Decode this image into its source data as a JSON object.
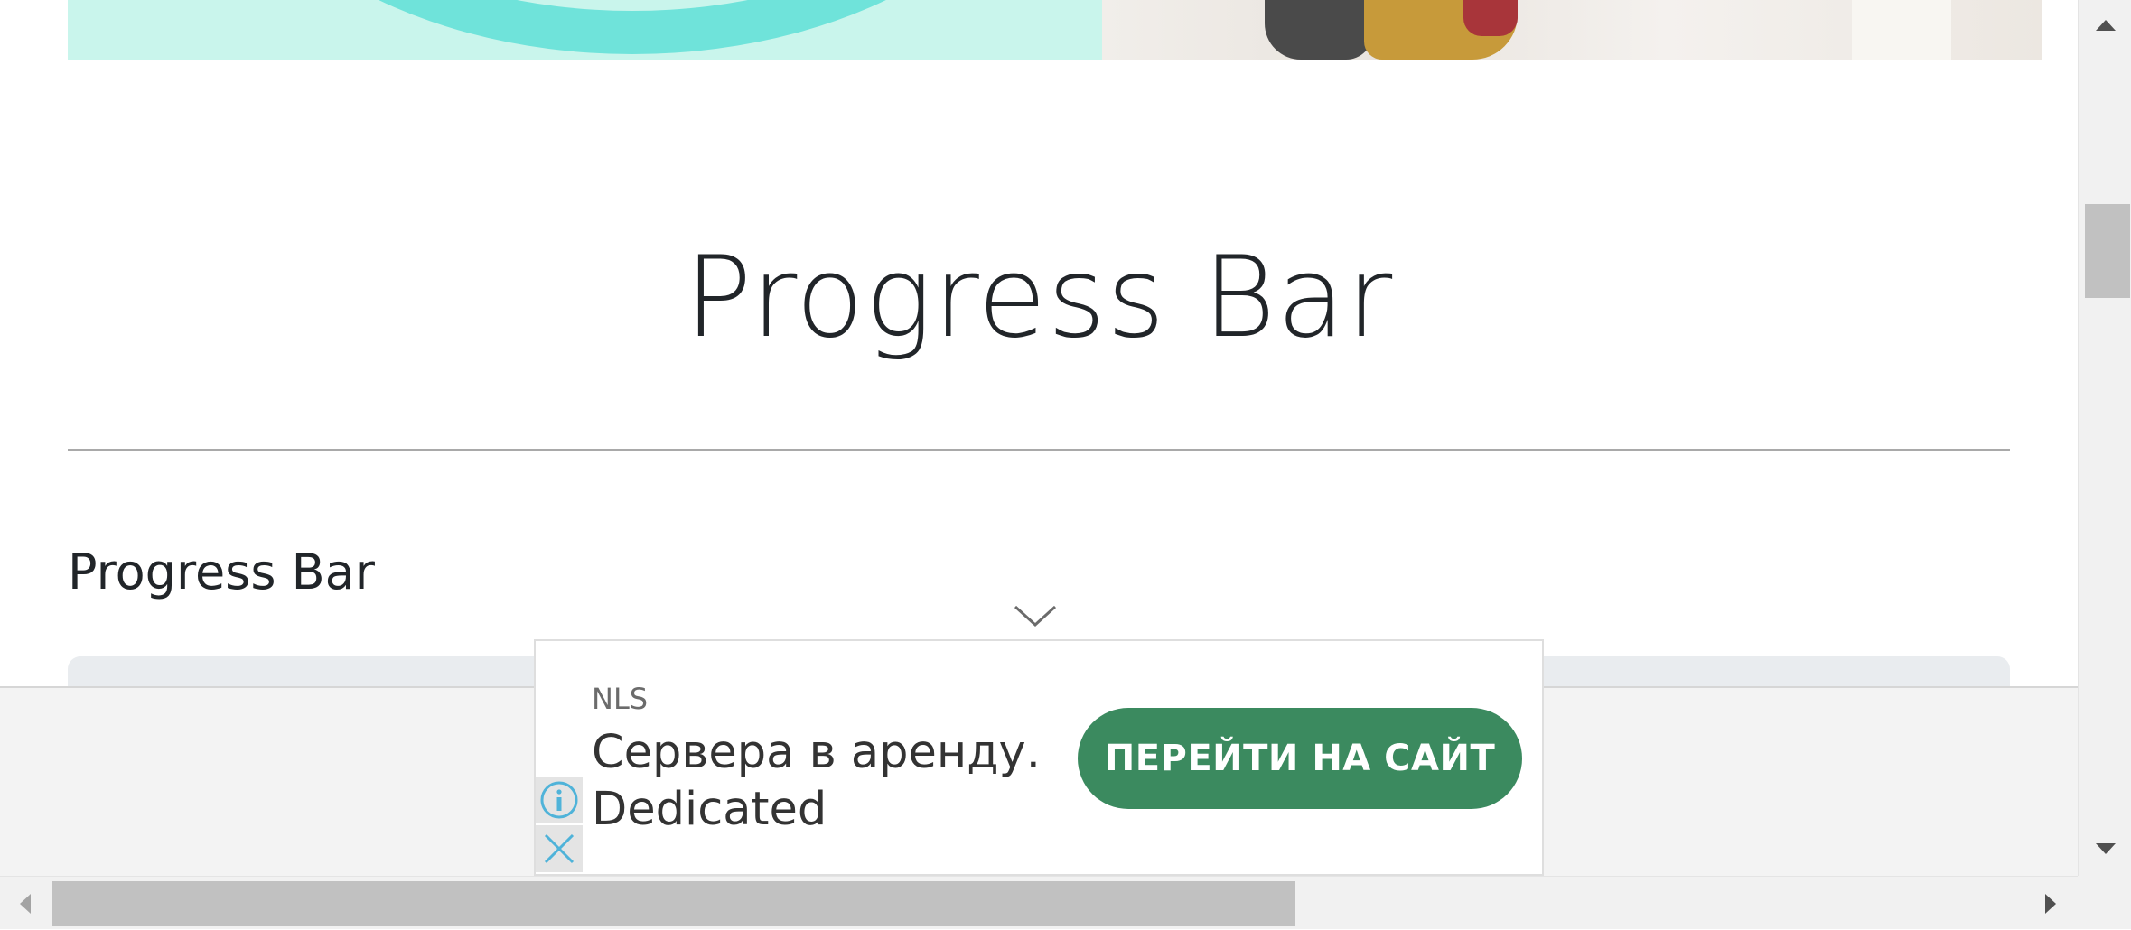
{
  "page": {
    "title": "Progress Bar",
    "section_heading": "Progress Bar"
  },
  "hero": {
    "colors": {
      "left_bg": "#c9f5ec",
      "ring": "#6fe3da"
    }
  },
  "ad": {
    "sponsor": "NLS",
    "text": "Сервера в аренду. Dedicated",
    "cta_label": "ПЕРЕЙТИ НА САЙТ",
    "cta_color": "#3b8a5f",
    "icons": {
      "collapse": "chevron-down-icon",
      "info": "info-icon",
      "close": "close-icon"
    }
  },
  "scrollbars": {
    "vertical": {
      "up_icon": "arrow-up-icon",
      "down_icon": "arrow-down-icon"
    },
    "horizontal": {
      "left_icon": "arrow-left-icon",
      "right_icon": "arrow-right-icon"
    }
  }
}
